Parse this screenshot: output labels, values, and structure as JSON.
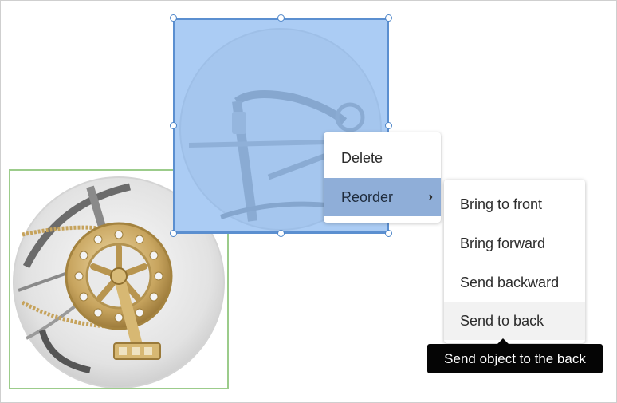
{
  "context_menu": {
    "items": [
      {
        "label": "Delete"
      },
      {
        "label": "Reorder",
        "submenu_indicator": "chevron-right-icon"
      }
    ],
    "active_item": "Reorder"
  },
  "submenu": {
    "items": [
      {
        "label": "Bring to front"
      },
      {
        "label": "Bring forward"
      },
      {
        "label": "Send backward"
      },
      {
        "label": "Send to back"
      }
    ],
    "hovered_item": "Send to back"
  },
  "tooltip": {
    "text": "Send object to the back"
  },
  "colors": {
    "selection_fill": "#8ab8f0",
    "selection_border": "#5b8fd0",
    "menu_active": "#8faed8",
    "crank_border": "#9ccc8b",
    "tooltip_bg": "#050505"
  }
}
